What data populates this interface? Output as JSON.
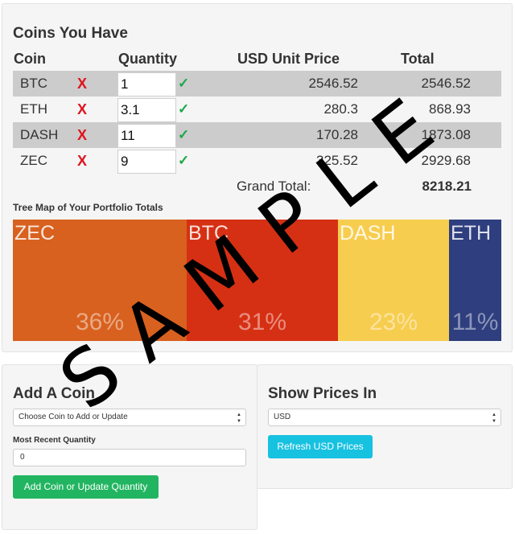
{
  "coins_section": {
    "title": "Coins You Have",
    "headers": {
      "coin": "Coin",
      "quantity": "Quantity",
      "price": "USD Unit Price",
      "total": "Total"
    },
    "remove_symbol": "X",
    "confirm_symbol": "✓",
    "rows": [
      {
        "coin": "BTC",
        "quantity": "1",
        "price": "2546.52",
        "total": "2546.52"
      },
      {
        "coin": "ETH",
        "quantity": "3.1",
        "price": "280.3",
        "total": "868.93"
      },
      {
        "coin": "DASH",
        "quantity": "11",
        "price": "170.28",
        "total": "1873.08"
      },
      {
        "coin": "ZEC",
        "quantity": "9",
        "price": "325.52",
        "total": "2929.68"
      }
    ],
    "grand_total_label": "Grand Total:",
    "grand_total_value": "8218.21"
  },
  "treemap": {
    "title": "Tree Map of Your Portfolio Totals",
    "tiles": [
      {
        "label": "ZEC",
        "percent": "36%",
        "color": "#d8611f"
      },
      {
        "label": "BTC",
        "percent": "31%",
        "color": "#d63014"
      },
      {
        "label": "DASH",
        "percent": "23%",
        "color": "#f7cd4f"
      },
      {
        "label": "ETH",
        "percent": "11%",
        "color": "#2e3e7e"
      }
    ]
  },
  "add_coin": {
    "title": "Add A Coin",
    "select_value": "Choose Coin to Add or Update",
    "quantity_label": "Most Recent Quantity",
    "quantity_value": "0",
    "button": "Add Coin or Update Quantity"
  },
  "show_prices": {
    "title": "Show Prices In",
    "currency_value": "USD",
    "button": "Refresh USD Prices"
  },
  "watermark": "SAMPLE"
}
